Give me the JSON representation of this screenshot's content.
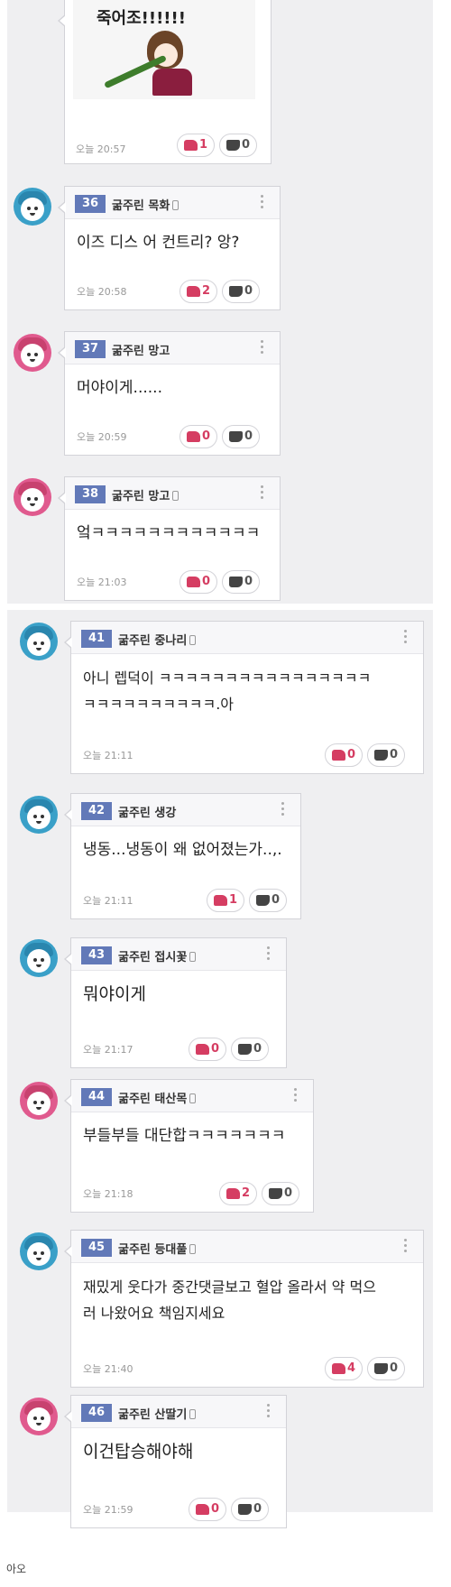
{
  "top_partial": {
    "sticker_text": "죽어조!!!!!!",
    "time": "오늘 20:57",
    "likes": "1",
    "dislikes": "0"
  },
  "comments": [
    {
      "num": "36",
      "author": "굶주린 목화",
      "body": [
        "이즈 디스 어 컨트리? 앙?"
      ],
      "time": "오늘 20:58",
      "likes": "2",
      "dislikes": "0"
    },
    {
      "num": "37",
      "author": "굶주린 망고",
      "body": [
        "머야이게......"
      ],
      "time": "오늘 20:59",
      "likes": "0",
      "dislikes": "0"
    },
    {
      "num": "38",
      "author": "굶주린 망고",
      "body": [
        "엌ㅋㅋㅋㅋㅋㅋㅋㅋㅋㅋㅋㅋ"
      ],
      "time": "오늘 21:03",
      "likes": "0",
      "dislikes": "0"
    },
    {
      "num": "41",
      "author": "굶주린 중나리",
      "body": [
        "아니 렙덕이 ㅋㅋㅋㅋㅋㅋㅋㅋㅋㅋㅋㅋㅋㅋㅋㅋ",
        "ㅋㅋㅋㅋㅋㅋㅋㅋㅋㅋ.아"
      ],
      "time": "오늘 21:11",
      "likes": "0",
      "dislikes": "0"
    },
    {
      "num": "42",
      "author": "굶주린 생강",
      "body": [
        "냉동...냉동이 왜 없어졌는가..,."
      ],
      "time": "오늘 21:11",
      "likes": "1",
      "dislikes": "0"
    },
    {
      "num": "43",
      "author": "굶주린 접시꽃",
      "body": [
        "뭐야이게"
      ],
      "time": "오늘 21:17",
      "likes": "0",
      "dislikes": "0"
    },
    {
      "num": "44",
      "author": "굶주린 태산목",
      "body": [
        "부들부들 대단합ㅋㅋㅋㅋㅋㅋㅋ"
      ],
      "time": "오늘 21:18",
      "likes": "2",
      "dislikes": "0"
    },
    {
      "num": "45",
      "author": "굶주린 등대풀",
      "body": [
        "재밌게 웃다가 중간댓글보고 혈압 올라서 약 먹으",
        "러 나왔어요 책임지세요"
      ],
      "time": "오늘 21:40",
      "likes": "4",
      "dislikes": "0"
    },
    {
      "num": "46",
      "author": "굶주린 산딸기",
      "body": [
        "이건탑승해야해"
      ],
      "time": "오늘 21:59",
      "likes": "0",
      "dislikes": "0"
    }
  ],
  "footer": {
    "text": "아오"
  },
  "colors": {
    "badge": "#6279b8",
    "like": "#d53d62",
    "avatar_blue": "#3aa0c8",
    "avatar_pink": "#e05a8e",
    "panel_bg": "#efeff1"
  },
  "icons": {
    "like": "thumbs-up-icon",
    "dislike": "thumbs-down-icon",
    "mobile": "mobile-phone-icon",
    "more": "more-vertical-icon"
  }
}
